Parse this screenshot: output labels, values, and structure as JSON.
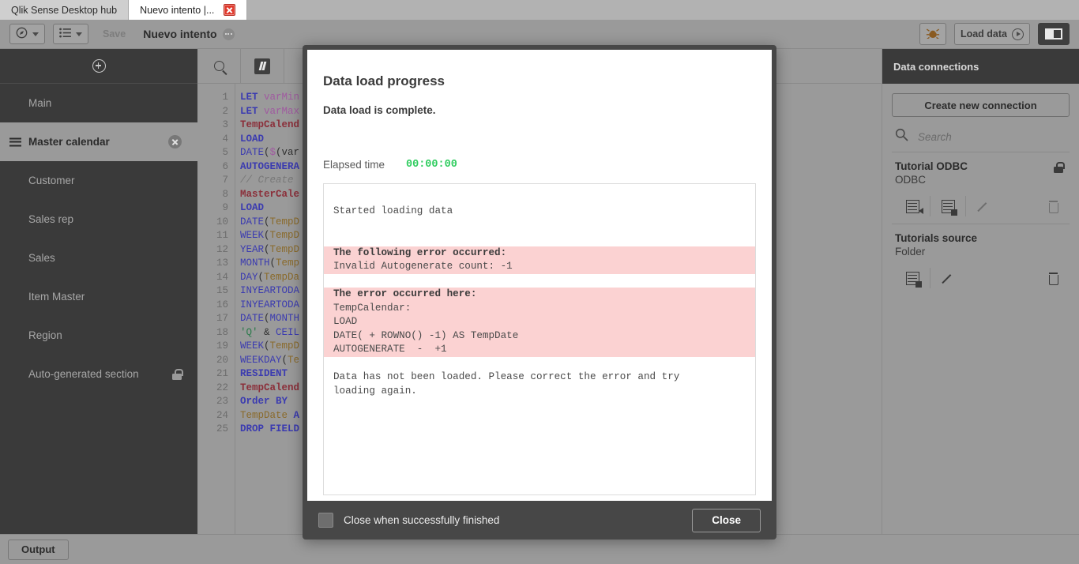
{
  "browser": {
    "tabs": [
      {
        "label": "Qlik Sense Desktop hub",
        "active": false,
        "closable": false
      },
      {
        "label": "Nuevo intento |...",
        "active": true,
        "closable": true
      }
    ]
  },
  "toolbar": {
    "nav_icon": "compass-icon",
    "sheets_icon": "list-icon",
    "save_label": "Save",
    "app_title": "Nuevo intento",
    "app_badge_icon": "more-dots-icon",
    "debug_icon": "debug-bug-icon",
    "load_data_label": "Load data",
    "load_data_icon": "play-circle-icon",
    "layout_icon": "panel-layout-icon"
  },
  "sidebar": {
    "add_icon": "plus-circle-icon",
    "items": [
      {
        "label": "Main",
        "selected": false,
        "locked": false,
        "closable": false
      },
      {
        "label": "Master calendar",
        "selected": true,
        "locked": false,
        "closable": true
      },
      {
        "label": "Customer",
        "selected": false,
        "locked": false,
        "closable": false
      },
      {
        "label": "Sales rep",
        "selected": false,
        "locked": false,
        "closable": false
      },
      {
        "label": "Sales",
        "selected": false,
        "locked": false,
        "closable": false
      },
      {
        "label": "Item Master",
        "selected": false,
        "locked": false,
        "closable": false
      },
      {
        "label": "Region",
        "selected": false,
        "locked": false,
        "closable": false
      },
      {
        "label": "Auto-generated section",
        "selected": false,
        "locked": true,
        "closable": false
      }
    ]
  },
  "editor": {
    "search_icon": "search-icon",
    "comment_icon": "comment-toggle-icon",
    "line_numbers": [
      "1",
      "2",
      "3",
      "4",
      "5",
      "6",
      "7",
      "8",
      "9",
      "10",
      "11",
      "12",
      "13",
      "14",
      "15",
      "16",
      "17",
      "18",
      "19",
      "20",
      "21",
      "22",
      "23",
      "24",
      "25"
    ],
    "lines": [
      [
        {
          "t": "LET ",
          "c": "k"
        },
        {
          "t": "varMin",
          "c": "v"
        }
      ],
      [
        {
          "t": "LET ",
          "c": "k"
        },
        {
          "t": "varMax",
          "c": "v"
        }
      ],
      [
        {
          "t": "TempCalend",
          "c": "t"
        }
      ],
      [
        {
          "t": "LOAD",
          "c": "k"
        }
      ],
      [
        {
          "t": "DATE",
          "c": "kf"
        },
        {
          "t": "(",
          "c": "p"
        },
        {
          "t": "$",
          "c": "v"
        },
        {
          "t": "(var",
          "c": "p"
        }
      ],
      [
        {
          "t": "AUTOGENERA",
          "c": "k"
        }
      ],
      [
        {
          "t": "// Create",
          "c": "c"
        }
      ],
      [
        {
          "t": "MasterCale",
          "c": "t"
        }
      ],
      [
        {
          "t": "LOAD",
          "c": "k"
        }
      ],
      [
        {
          "t": "DATE",
          "c": "kf"
        },
        {
          "t": "(",
          "c": "p"
        },
        {
          "t": "TempD",
          "c": "f"
        }
      ],
      [
        {
          "t": "WEEK",
          "c": "kf"
        },
        {
          "t": "(",
          "c": "p"
        },
        {
          "t": "TempD",
          "c": "f"
        }
      ],
      [
        {
          "t": "YEAR",
          "c": "kf"
        },
        {
          "t": "(",
          "c": "p"
        },
        {
          "t": "TempD",
          "c": "f"
        }
      ],
      [
        {
          "t": "MONTH",
          "c": "kf"
        },
        {
          "t": "(",
          "c": "p"
        },
        {
          "t": "Temp",
          "c": "f"
        }
      ],
      [
        {
          "t": "DAY",
          "c": "kf"
        },
        {
          "t": "(",
          "c": "p"
        },
        {
          "t": "TempDa",
          "c": "f"
        }
      ],
      [
        {
          "t": "INYEARTODA",
          "c": "kf"
        }
      ],
      [
        {
          "t": "INYEARTODA",
          "c": "kf"
        }
      ],
      [
        {
          "t": "DATE",
          "c": "kf"
        },
        {
          "t": "(",
          "c": "p"
        },
        {
          "t": "MONTH",
          "c": "kf"
        }
      ],
      [
        {
          "t": "'Q'",
          "c": "s"
        },
        {
          "t": " & ",
          "c": "p"
        },
        {
          "t": "CEIL",
          "c": "kf"
        }
      ],
      [
        {
          "t": "WEEK",
          "c": "kf"
        },
        {
          "t": "(",
          "c": "p"
        },
        {
          "t": "TempD",
          "c": "f"
        }
      ],
      [
        {
          "t": "WEEKDAY",
          "c": "kf"
        },
        {
          "t": "(",
          "c": "p"
        },
        {
          "t": "Te",
          "c": "f"
        }
      ],
      [
        {
          "t": "RESIDENT",
          "c": "k"
        }
      ],
      [
        {
          "t": "TempCalend",
          "c": "t"
        }
      ],
      [
        {
          "t": "Order BY",
          "c": "k"
        }
      ],
      [
        {
          "t": "TempDate ",
          "c": "f"
        },
        {
          "t": "A",
          "c": "k"
        }
      ],
      [
        {
          "t": "DROP FIELD",
          "c": "k"
        }
      ]
    ]
  },
  "right_panel": {
    "header": "Data connections",
    "create_button": "Create new connection",
    "search_icon": "search-icon",
    "search_placeholder": "Search",
    "search_value": "",
    "connections": [
      {
        "name": "Tutorial ODBC",
        "type": "ODBC",
        "locked": true,
        "actions": [
          "insert-script-icon",
          "select-data-icon",
          "edit-icon",
          "delete-icon"
        ],
        "edit_disabled": true,
        "delete_disabled": true
      },
      {
        "name": "Tutorials source",
        "type": "Folder",
        "locked": false,
        "actions": [
          "select-data-icon",
          "edit-icon",
          "delete-icon"
        ],
        "edit_disabled": false,
        "delete_disabled": false
      }
    ]
  },
  "bottom_bar": {
    "output_label": "Output"
  },
  "dialog": {
    "title": "Data load progress",
    "subtitle": "Data load is complete.",
    "elapsed_label": "Elapsed time",
    "elapsed_value": "00:00:00",
    "elapsed_color": "#2ecc5e",
    "error_bg": "#fbd2d2",
    "log": [
      {
        "text": "Started loading data",
        "error": false,
        "bold": false
      },
      {
        "text": "",
        "error": false,
        "bold": false,
        "spacer": true
      },
      {
        "text": "",
        "error": false,
        "bold": false,
        "spacer": true
      },
      {
        "text": "The following error occurred:",
        "error": true,
        "bold": true
      },
      {
        "text": "Invalid Autogenerate count: -1",
        "error": true,
        "bold": false
      },
      {
        "text": "",
        "error": false,
        "bold": false,
        "spacer": true
      },
      {
        "text": "The error occurred here:",
        "error": true,
        "bold": true
      },
      {
        "text": "TempCalendar:",
        "error": true,
        "bold": false
      },
      {
        "text": "LOAD",
        "error": true,
        "bold": false
      },
      {
        "text": "DATE( + ROWNO() -1) AS TempDate",
        "error": true,
        "bold": false
      },
      {
        "text": "AUTOGENERATE  -  +1",
        "error": true,
        "bold": false
      },
      {
        "text": "",
        "error": false,
        "bold": false,
        "spacer": true
      },
      {
        "text": "Data has not been loaded. Please correct the error and try",
        "error": false,
        "bold": false
      },
      {
        "text": "loading again.",
        "error": false,
        "bold": false
      }
    ],
    "checkbox_label": "Close when successfully finished",
    "checkbox_checked": false,
    "close_button": "Close"
  }
}
